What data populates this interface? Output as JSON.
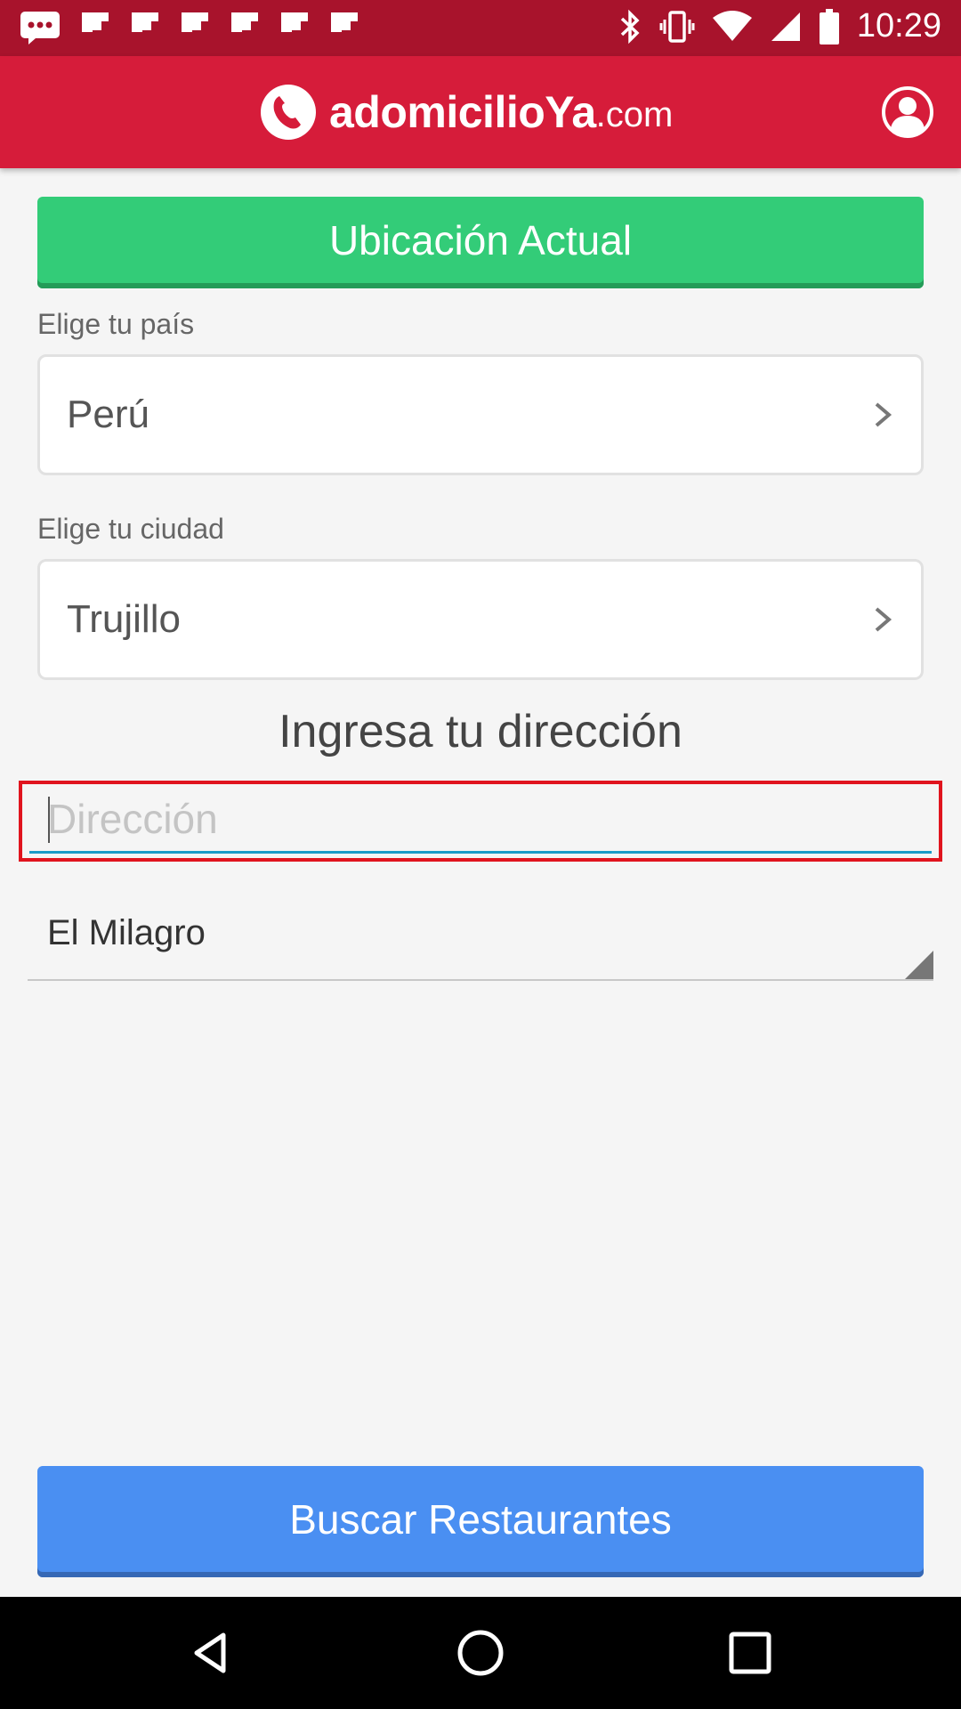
{
  "status_bar": {
    "time": "10:29",
    "icons": [
      "message-icon",
      "flipboard-icon",
      "flipboard-icon",
      "flipboard-icon",
      "flipboard-icon",
      "flipboard-icon",
      "flipboard-icon",
      "bluetooth-icon",
      "vibrate-icon",
      "wifi-icon",
      "signal-icon",
      "battery-icon"
    ]
  },
  "header": {
    "logo_name": "adomicilioYa",
    "logo_tld": ".com",
    "profile_icon": "user-circle-icon"
  },
  "current_location_button": "Ubicación Actual",
  "country": {
    "label": "Elige tu país",
    "value": "Perú"
  },
  "city": {
    "label": "Elige tu ciudad",
    "value": "Trujillo"
  },
  "address": {
    "title": "Ingresa tu dirección",
    "placeholder": "Dirección",
    "value": ""
  },
  "district": {
    "value": "El Milagro"
  },
  "search_button": "Buscar Restaurantes",
  "nav": {
    "back_icon": "back-triangle-icon",
    "home_icon": "home-circle-icon",
    "recents_icon": "recents-square-icon"
  },
  "colors": {
    "status_bar": "#a8132c",
    "header": "#d61c3a",
    "location_button": "#33cc78",
    "search_button": "#4a8ff2",
    "input_focus": "#1a9bc7",
    "highlight_border": "#e0141e"
  }
}
